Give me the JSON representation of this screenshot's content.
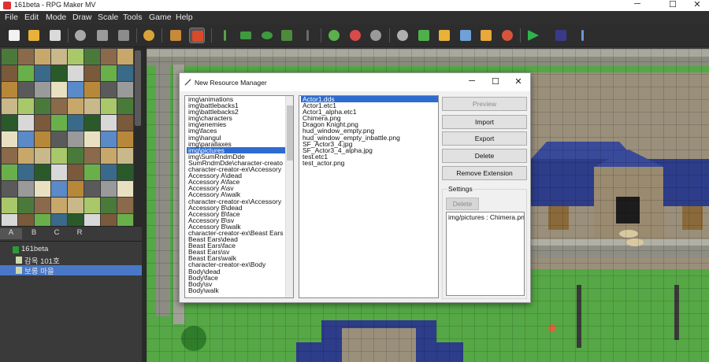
{
  "window": {
    "title": "161beta - RPG Maker MV",
    "minimize": "─",
    "maximize": "☐",
    "close": "✕"
  },
  "menu": [
    "File",
    "Edit",
    "Mode",
    "Draw",
    "Scale",
    "Tools",
    "Game",
    "Help"
  ],
  "toolbar": {
    "icons": [
      "new-project-icon",
      "open-project-icon",
      "save-project-icon",
      "cut-icon",
      "copy-icon",
      "paste-icon",
      "undo-icon",
      "map-mode-icon",
      "event-mode-icon",
      "pencil-icon",
      "rectangle-icon",
      "ellipse-icon",
      "fill-icon",
      "shadow-pen-icon",
      "zoom-in-icon",
      "zoom-out-icon",
      "actual-size-icon",
      "database-icon",
      "plugin-manager-icon",
      "sound-test-icon",
      "event-searcher-icon",
      "resource-manager-icon",
      "character-generator-icon",
      "playtest-icon",
      "dv-icon",
      "script-icon"
    ]
  },
  "tileset_tabs": [
    "A",
    "B",
    "C",
    "R"
  ],
  "map_tree": {
    "project": "161beta",
    "maps": [
      "감옥 101호",
      "보롱 마을"
    ]
  },
  "dialog": {
    "title": "New Resource Manager",
    "folders": [
      "img\\animations",
      "img\\battlebacks1",
      "img\\battlebacks2",
      "img\\characters",
      "img\\enemies",
      "img\\faces",
      "img\\hangul",
      "img\\parallaxes",
      "img\\pictures",
      "img\\SumRndmDde",
      "SumRndmDde\\character-creato",
      "character-creator-ex\\Accessory",
      "Accessory A\\dead",
      "Accessory A\\face",
      "Accessory A\\sv",
      "Accessory A\\walk",
      "character-creator-ex\\Accessory",
      "Accessory B\\dead",
      "Accessory B\\face",
      "Accessory B\\sv",
      "Accessory B\\walk",
      "character-creator-ex\\Beast Ears",
      "Beast Ears\\dead",
      "Beast Ears\\face",
      "Beast Ears\\sv",
      "Beast Ears\\walk",
      "character-creator-ex\\Body",
      "Body\\dead",
      "Body\\face",
      "Body\\sv",
      "Body\\walk"
    ],
    "selected_folder": "img\\pictures",
    "files": [
      "Actor1.dds",
      "Actor1.etc1",
      "Actor1_alpha.etc1",
      "Chimera.png",
      "Dragon Knight.png",
      "hud_window_empty.png",
      "hud_window_empty_inbattle.png",
      "SF_Actor3_4.jpg",
      "SF_Actor3_4_alpha.jpg",
      "test.etc1",
      "test_actor.png"
    ],
    "selected_file": "Actor1.dds",
    "buttons": {
      "preview": "Preview",
      "import": "Import",
      "export": "Export",
      "delete": "Delete",
      "remove_extension": "Remove Extension"
    },
    "settings": {
      "label": "Settings",
      "delete": "Delete",
      "value": "img/pictures : Chimera.pn"
    }
  }
}
